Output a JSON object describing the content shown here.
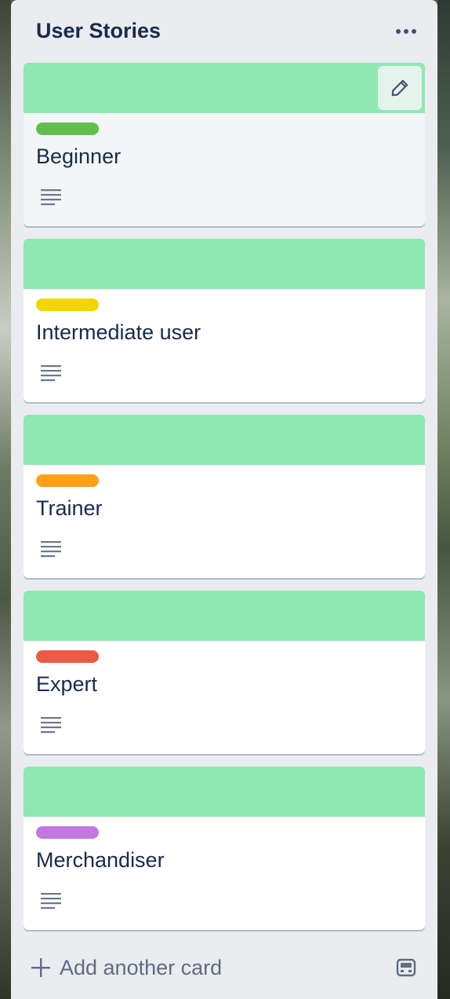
{
  "list": {
    "title": "User Stories",
    "menu_icon": "more-horizontal-icon"
  },
  "cards": [
    {
      "title": "Beginner",
      "label_color": "#61bd4f",
      "cover_color": "#8fe8b2",
      "has_description": true,
      "hovered": true
    },
    {
      "title": "Intermediate user",
      "label_color": "#f2d600",
      "cover_color": "#8fe8b2",
      "has_description": true
    },
    {
      "title": "Trainer",
      "label_color": "#ff9f1a",
      "cover_color": "#8fe8b2",
      "has_description": true
    },
    {
      "title": "Expert",
      "label_color": "#eb5a46",
      "cover_color": "#8fe8b2",
      "has_description": true
    },
    {
      "title": "Merchandiser",
      "label_color": "#c377e0",
      "cover_color": "#8fe8b2",
      "has_description": true
    }
  ],
  "footer": {
    "add_card_label": "Add another card",
    "add_icon": "plus-icon",
    "template_icon": "card-template-icon"
  },
  "colors": {
    "list_bg": "#ebecf0",
    "text": "#172b4d",
    "muted": "#5e6c84"
  }
}
